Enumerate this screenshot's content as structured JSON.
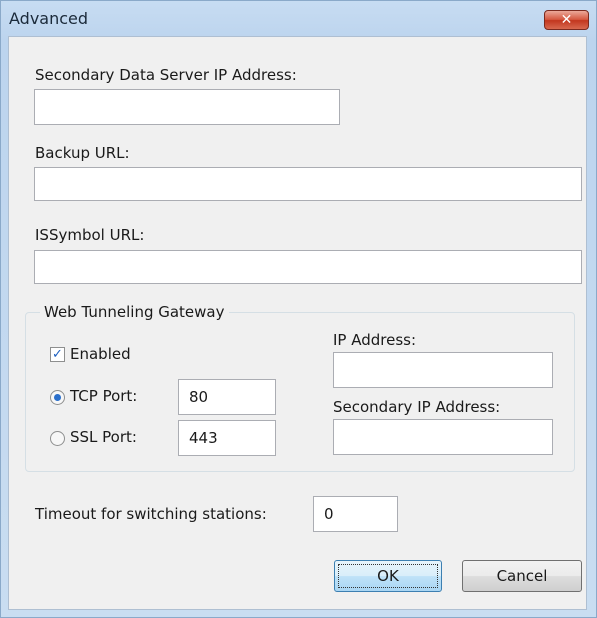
{
  "window": {
    "title": "Advanced",
    "close_icon": "close-x-icon"
  },
  "fields": {
    "secondary_data_server_label": "Secondary Data Server IP Address:",
    "secondary_data_server_value": "",
    "backup_url_label": "Backup URL:",
    "backup_url_value": "",
    "issymbol_url_label": "ISSymbol URL:",
    "issymbol_url_value": ""
  },
  "gateway": {
    "legend": "Web Tunneling Gateway",
    "enabled_label": "Enabled",
    "enabled_checked": true,
    "tcp_label": "TCP Port:",
    "tcp_value": "80",
    "tcp_selected": true,
    "ssl_label": "SSL Port:",
    "ssl_value": "443",
    "ip_label": "IP Address:",
    "ip_value": "",
    "secondary_ip_label": "Secondary IP Address:",
    "secondary_ip_value": ""
  },
  "timeout": {
    "label": "Timeout for switching stations:",
    "value": "0"
  },
  "buttons": {
    "ok": "OK",
    "cancel": "Cancel"
  },
  "colors": {
    "title_bg": "#bfd6ef",
    "close_red": "#c9432a",
    "dialog_bg": "#f0f0f0"
  }
}
